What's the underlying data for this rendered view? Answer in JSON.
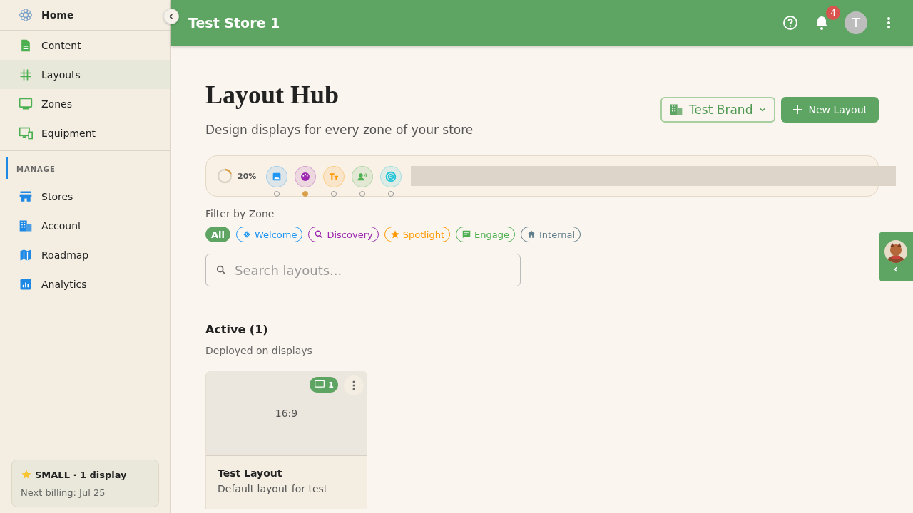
{
  "sidebar": {
    "home": {
      "label": "Home"
    },
    "items": [
      {
        "label": "Content",
        "selected": false
      },
      {
        "label": "Layouts",
        "selected": true
      },
      {
        "label": "Zones",
        "selected": false
      },
      {
        "label": "Equipment",
        "selected": false
      }
    ],
    "section": "MANAGE",
    "manage_items": [
      {
        "label": "Stores",
        "selected": false
      },
      {
        "label": "Account",
        "selected": false
      },
      {
        "label": "Roadmap",
        "selected": false
      },
      {
        "label": "Analytics",
        "selected": false
      }
    ],
    "plan": {
      "title": "SMALL · 1 display",
      "billing": "Next billing: Jul 25"
    }
  },
  "header": {
    "title": "Test Store 1",
    "notifications": "4",
    "avatar": "T"
  },
  "page": {
    "title": "Layout Hub",
    "subtitle": "Design displays for every zone of your store",
    "brand_select": {
      "value": "Test Brand"
    },
    "new_button": "New Layout",
    "progress": {
      "level": 0.2,
      "reading": "20%"
    },
    "steps": [
      {
        "color": "#2196f3",
        "selected": false
      },
      {
        "color": "#9c27b0",
        "selected": true
      },
      {
        "color": "#ff9800",
        "selected": false
      },
      {
        "color": "#4caf50",
        "selected": false
      },
      {
        "color": "#26c6da",
        "selected": false
      }
    ],
    "filter_label": "Filter by Zone",
    "zones": [
      {
        "label": "All",
        "selected": true,
        "color": "#5ea463"
      },
      {
        "label": "Welcome",
        "selected": false,
        "color": "#2196f3"
      },
      {
        "label": "Discovery",
        "selected": false,
        "color": "#9c27b0"
      },
      {
        "label": "Spotlight",
        "selected": false,
        "color": "#ff9800"
      },
      {
        "label": "Engage",
        "selected": false,
        "color": "#4caf50"
      },
      {
        "label": "Internal",
        "selected": false,
        "color": "#607d8b"
      }
    ],
    "search": {
      "placeholder": "Search layouts..."
    },
    "section": {
      "title": "Active (1)",
      "subtitle": "Deployed on displays"
    },
    "cards": [
      {
        "ratio": "16:9",
        "displays": "1",
        "title": "Test Layout",
        "description": "Default layout for test"
      }
    ]
  }
}
